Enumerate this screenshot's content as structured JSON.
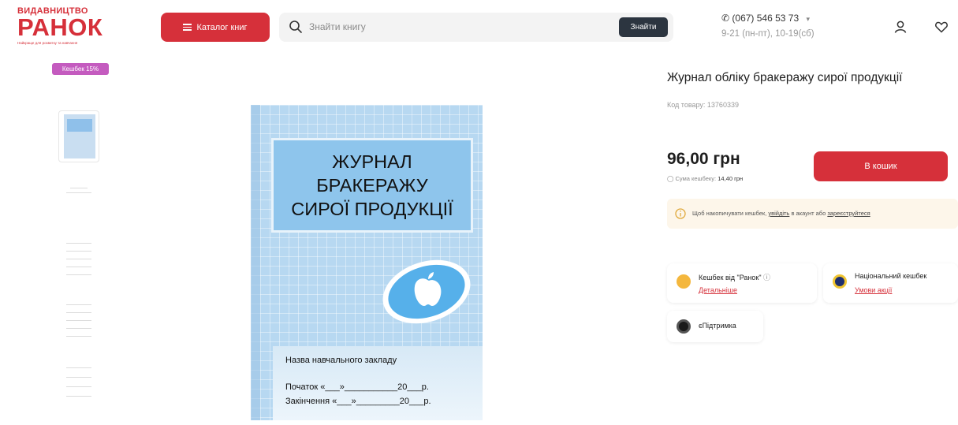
{
  "header": {
    "logo_top": "ВИДАВНИЦТВО",
    "logo_main": "РАНОК",
    "logo_sub": "Найкраще для розвитку та навчання",
    "catalog_label": "Каталог книг",
    "search_placeholder": "Знайти книгу",
    "search_button": "Знайти",
    "phone": "(067) 546 53 73",
    "hours": "9-21 (пн-пт), 10-19(сб)",
    "icons": [
      "phone-icon",
      "user-icon",
      "heart-icon"
    ]
  },
  "gallery": {
    "badge": "Кешбек 15%",
    "thumbnails_count": 5
  },
  "cover": {
    "title_lines": [
      "ЖУРНАЛ",
      "БРАКЕРАЖУ",
      "СИРОЇ ПРОДУКЦІЇ"
    ],
    "school": "Назва навчального закладу",
    "start_line": "Початок «___»___________20___р.",
    "end_line": "Закінчення «___»_________20___р."
  },
  "product": {
    "title": "Журнал обліку бракеражу сирої продукції",
    "code": "Код товару: 13760339",
    "price": "96,00 грн",
    "cashback_label": "Сума кешбеку:",
    "cashback_value": "14,40 грн",
    "cart_button": "В кошик",
    "notice_prefix": "Щоб накопичувати кешбек,",
    "notice_login": "увійдіть",
    "notice_middle": "в акаунт або",
    "notice_register": "зареєструйтеся"
  },
  "benefits": [
    {
      "title": "Кешбек від \"Ранок\"",
      "link": "Детальніше",
      "icon": "cashback-coin-icon"
    },
    {
      "title": "Національний кешбек",
      "link": "Умови акції",
      "icon": "national-cashback-icon"
    },
    {
      "title": "єПідтримка",
      "icon": "esupport-icon"
    }
  ],
  "colors": {
    "accent": "#d6303a",
    "dark_button": "#2c3540",
    "badge": "#c45bbf",
    "cover_blue": "#b7d8f1"
  }
}
